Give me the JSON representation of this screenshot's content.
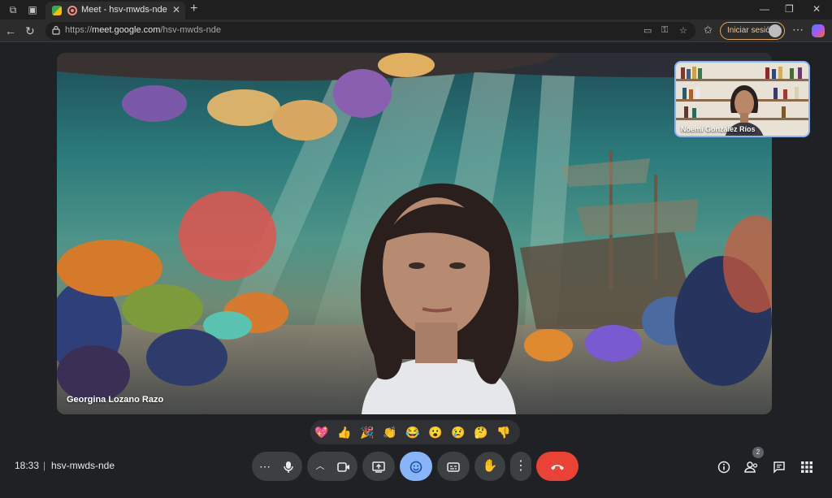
{
  "browser": {
    "tab_title": "Meet - hsv-mwds-nde",
    "url_scheme": "https://",
    "url_host": "meet.google.com",
    "url_path": "/hsv-mwds-nde",
    "signin_label": "Iniciar sesión"
  },
  "meeting": {
    "time": "18:33",
    "separator": "|",
    "code": "hsv-mwds-nde",
    "main_participant": "Georgina Lozano Razo",
    "self_participant": "Noemí González Ríos",
    "participant_count": "2"
  },
  "reactions": [
    "💖",
    "👍",
    "🎉",
    "👏",
    "😂",
    "😮",
    "😢",
    "🤔",
    "👎"
  ],
  "colors": {
    "accent_blue": "#8ab4f8",
    "leave_red": "#ea4335",
    "background": "#202124"
  }
}
